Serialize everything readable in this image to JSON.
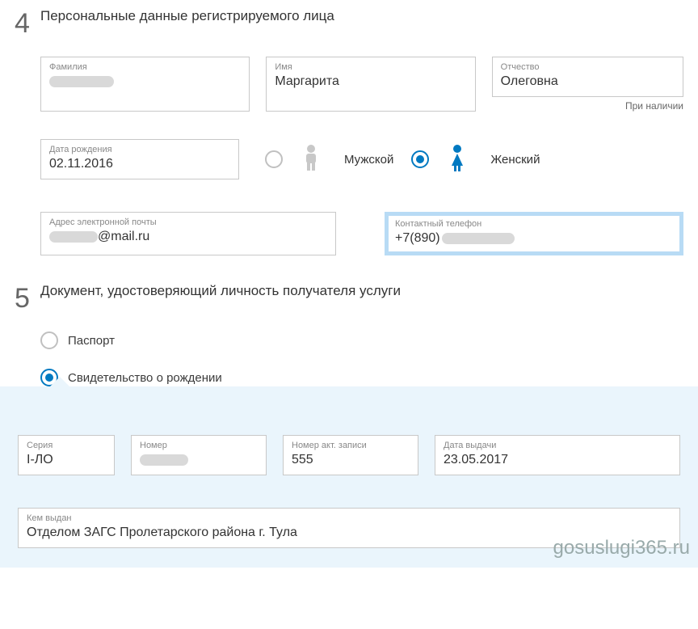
{
  "section4": {
    "num": "4",
    "title": "Персональные данные регистрируемого лица",
    "famLabel": "Фамилия",
    "nameLabel": "Имя",
    "nameVal": "Маргарита",
    "patroLabel": "Отчество",
    "patroVal": "Олеговна",
    "hint": "При наличии",
    "dobLabel": "Дата рождения",
    "dobVal": "02.11.2016",
    "maleLabel": "Мужской",
    "femaleLabel": "Женский",
    "emailLabel": "Адрес электронной почты",
    "emailSuffix": "@mail.ru",
    "phoneLabel": "Контактный телефон",
    "phonePrefix": "+7(890)"
  },
  "section5": {
    "num": "5",
    "title": "Документ, удостоверяющий личность получателя услуги",
    "opt1": "Паспорт",
    "opt2": "Свидетельство о рождении",
    "seriesLabel": "Серия",
    "seriesVal": "I-ЛО",
    "numLabel": "Номер",
    "recLabel": "Номер акт. записи",
    "recVal": "555",
    "issueDateLabel": "Дата выдачи",
    "issueDateVal": "23.05.2017",
    "issuerLabel": "Кем выдан",
    "issuerVal": "Отделом ЗАГС Пролетарского района г. Тула"
  },
  "watermark": "gosuslugi365.ru"
}
